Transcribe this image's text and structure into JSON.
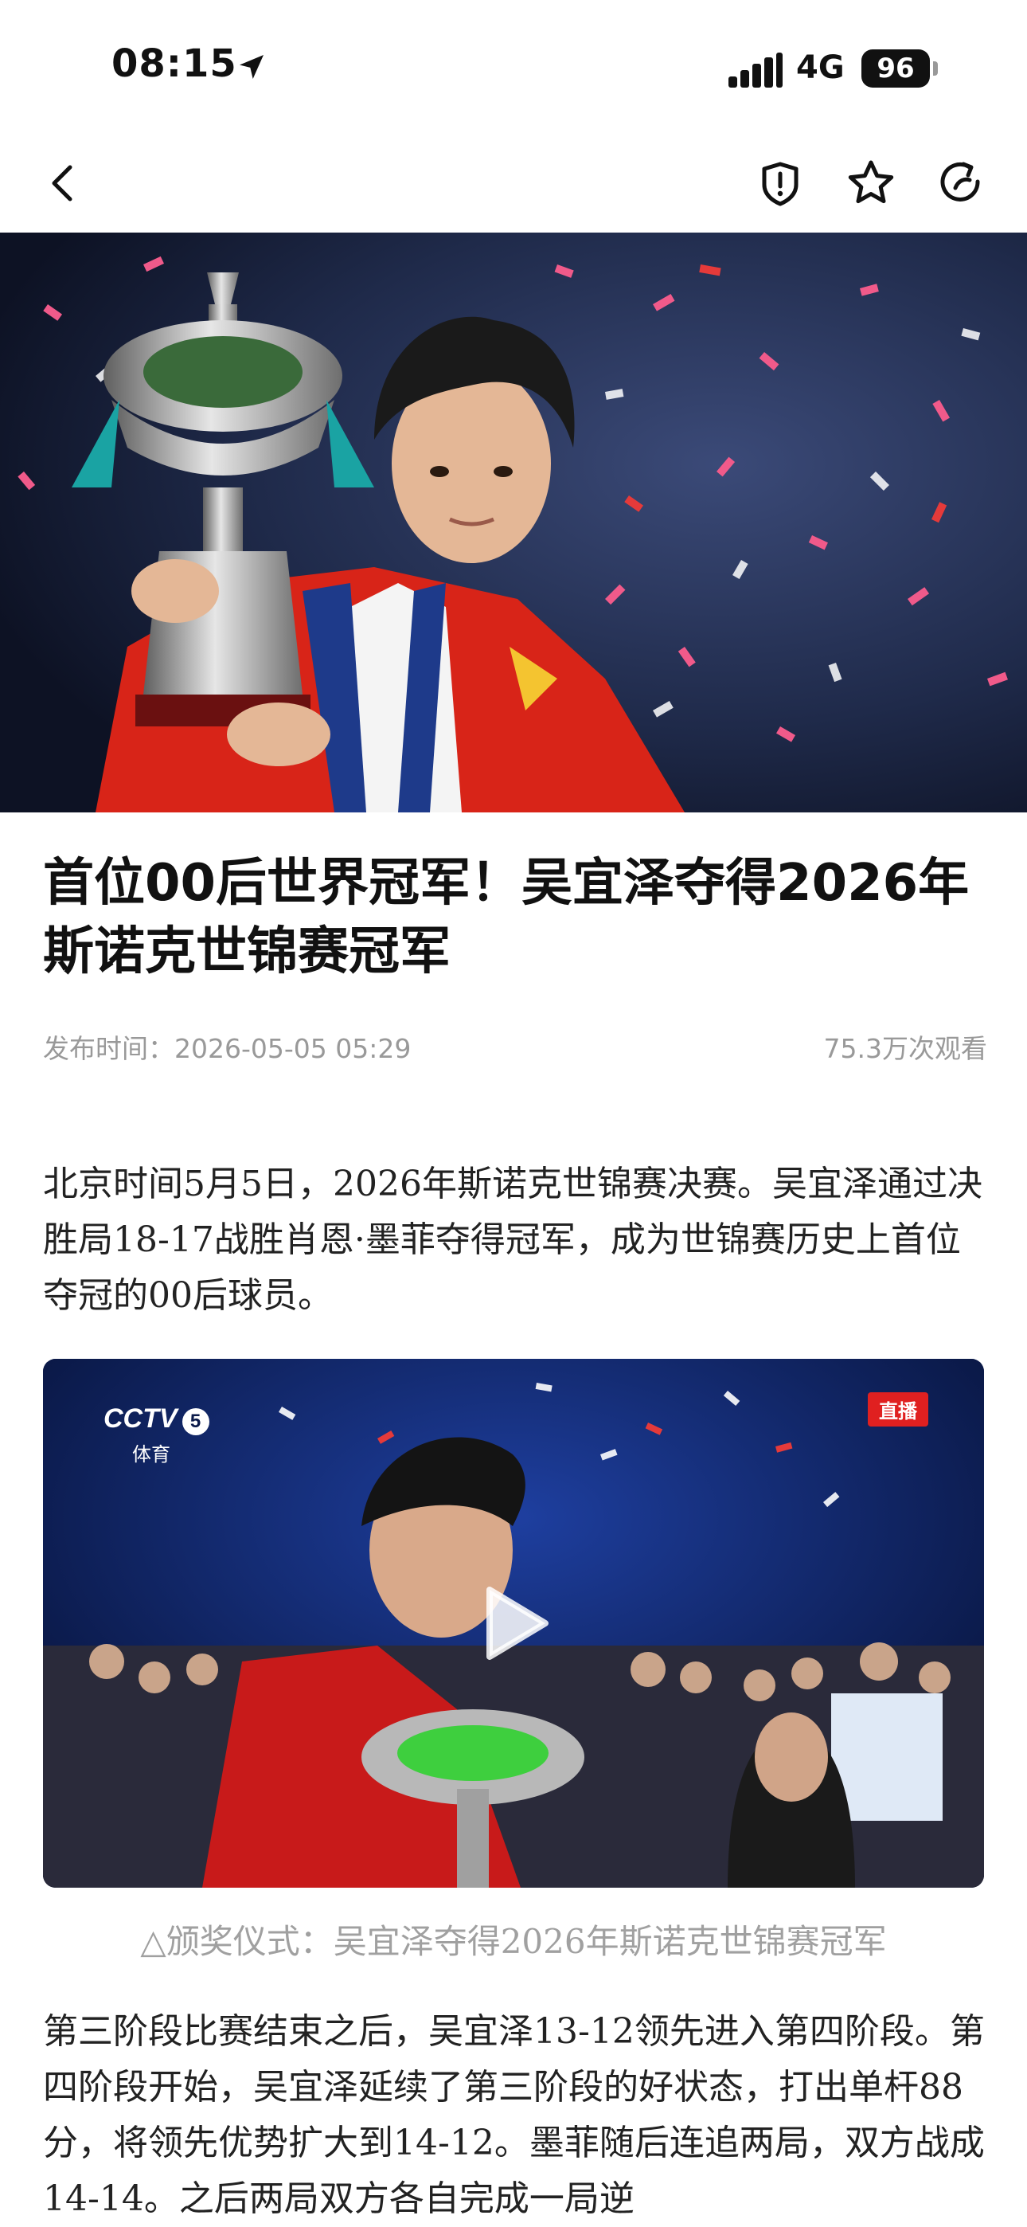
{
  "status_bar": {
    "time": "08:15",
    "network": "4G",
    "battery": "96",
    "icons": [
      "location-arrow-icon",
      "signal-icon",
      "battery-icon"
    ]
  },
  "nav": {
    "icons": [
      "back-chevron-icon",
      "report-shield-icon",
      "star-icon",
      "share-refresh-icon"
    ]
  },
  "article": {
    "title": "首位00后世界冠军！吴宜泽夺得2026年斯诺克世锦赛冠军",
    "publish_label": "发布时间：",
    "publish_time": "2026-05-05 05:29",
    "views": "75.3万次观看",
    "paragraph1": "北京时间5月5日，2026年斯诺克世锦赛决赛。吴宜泽通过决胜局18-17战胜肖恩·墨菲夺得冠军，成为世锦赛历史上首位夺冠的00后球员。",
    "video": {
      "channel_logo": "CCTV",
      "channel_number": "5",
      "channel_sub": "体育",
      "live_badge": "直播"
    },
    "caption": "△颁奖仪式：吴宜泽夺得2026年斯诺克世锦赛冠军",
    "paragraph2": "第三阶段比赛结束之后，吴宜泽13-12领先进入第四阶段。第四阶段开始，吴宜泽延续了第三阶段的好状态，打出单杆88分，将领先优势扩大到14-12。墨菲随后连追两局，双方战成14-14。之后两局双方各自完成一局逆"
  },
  "colors": {
    "text": "#111111",
    "meta": "#999999",
    "caption": "#a0a0a0",
    "live_red": "#e02020",
    "video_bg": "#0b1a4a"
  }
}
